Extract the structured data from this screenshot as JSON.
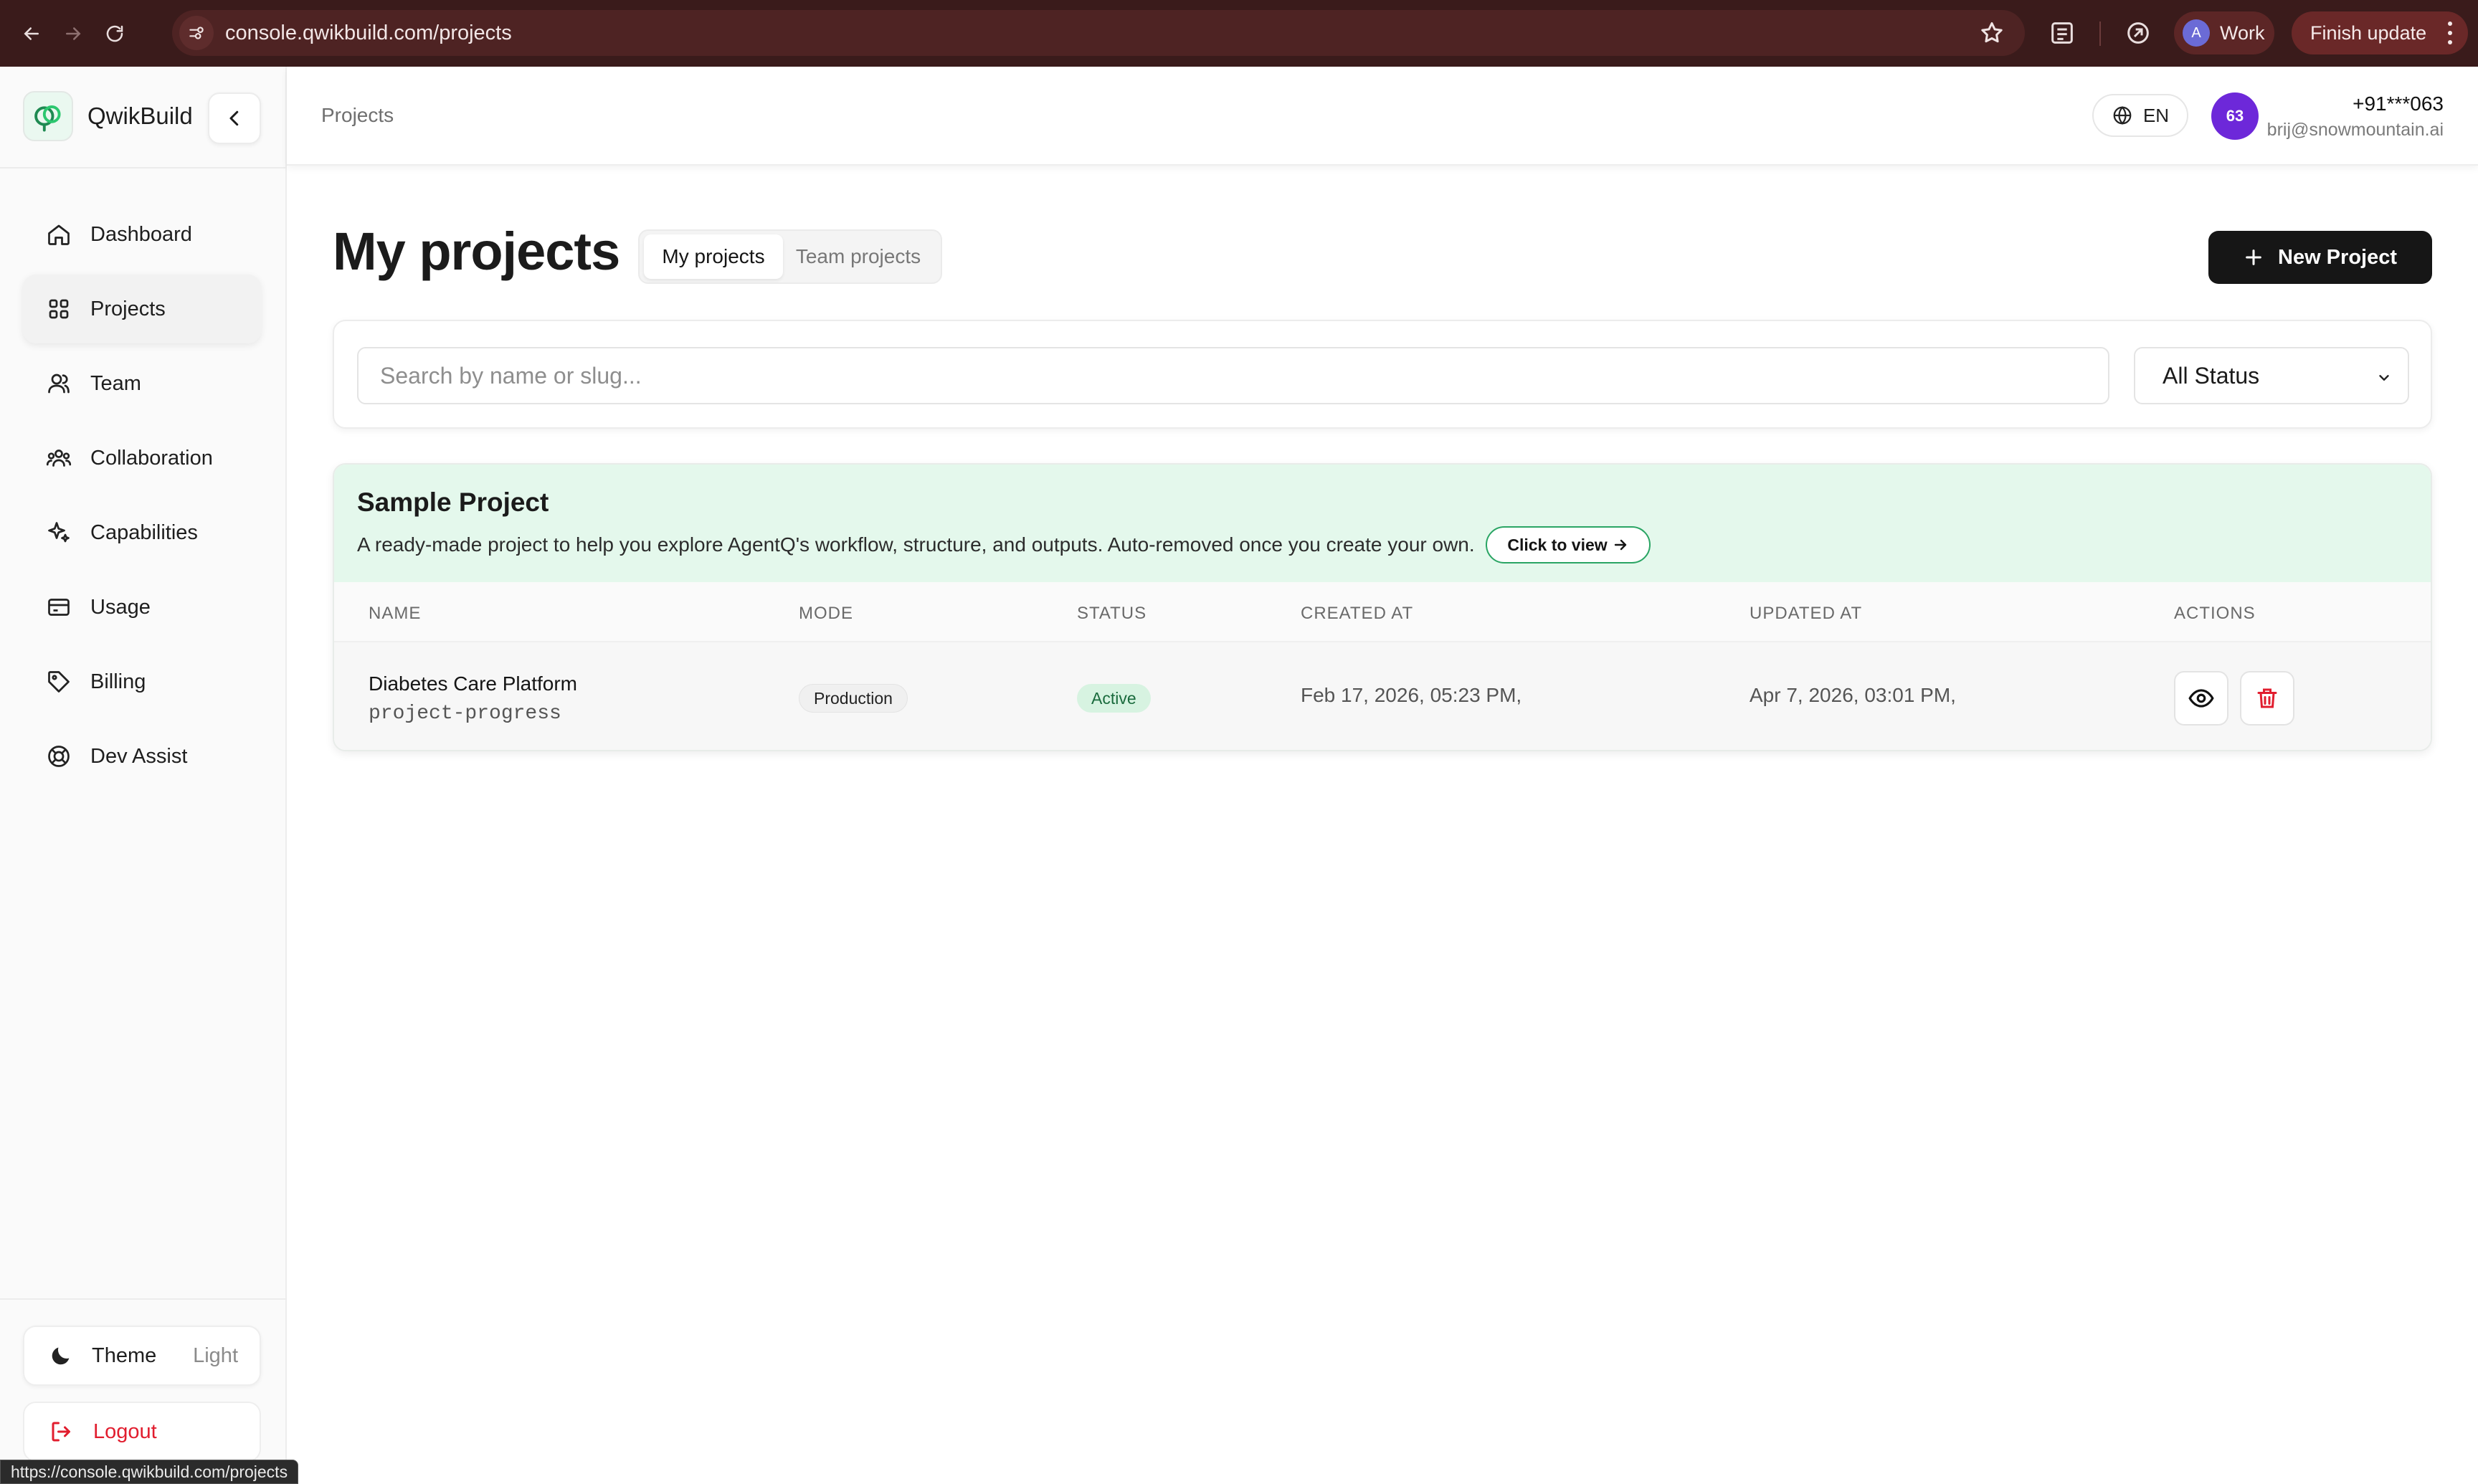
{
  "browser": {
    "url": "console.qwikbuild.com/projects",
    "profile_initial": "A",
    "profile_label": "Work",
    "update_label": "Finish update",
    "status_url": "https://console.qwikbuild.com/projects"
  },
  "sidebar": {
    "brand": "QwikBuild",
    "items": [
      {
        "label": "Dashboard",
        "icon": "home-icon"
      },
      {
        "label": "Projects",
        "icon": "grid-icon",
        "active": true
      },
      {
        "label": "Team",
        "icon": "users-icon"
      },
      {
        "label": "Collaboration",
        "icon": "group-icon"
      },
      {
        "label": "Capabilities",
        "icon": "sparkle-icon"
      },
      {
        "label": "Usage",
        "icon": "card-icon"
      },
      {
        "label": "Billing",
        "icon": "tag-icon"
      },
      {
        "label": "Dev Assist",
        "icon": "lifebuoy-icon"
      }
    ],
    "theme_label": "Theme",
    "theme_value": "Light",
    "logout_label": "Logout"
  },
  "header": {
    "breadcrumb": "Projects",
    "lang": "EN",
    "avatar": "63",
    "phone": "+91***063",
    "email": "brij@snowmountain.ai"
  },
  "main": {
    "title": "My projects",
    "tabs": [
      "My projects",
      "Team projects"
    ],
    "new_project": "New Project",
    "search_placeholder": "Search by name or slug...",
    "status_filter": "All Status"
  },
  "sample": {
    "title": "Sample Project",
    "description": "A ready-made project to help you explore AgentQ's workflow, structure, and outputs. Auto-removed once you create your own.",
    "view_label": "Click to view"
  },
  "table": {
    "headers": [
      "NAME",
      "MODE",
      "STATUS",
      "CREATED AT",
      "UPDATED AT",
      "ACTIONS"
    ],
    "rows": [
      {
        "name": "Diabetes Care Platform",
        "slug": "project-progress",
        "mode": "Production",
        "status": "Active",
        "created": "Feb 17, 2026, 05:23 PM,",
        "updated": "Apr 7, 2026, 03:01 PM,"
      }
    ]
  },
  "colors": {
    "accent_dark": "#161616",
    "sample_bg": "#e4f8ec",
    "active_badge": "#d7f3e1",
    "danger": "#e11d2e",
    "avatar": "#6d28d9",
    "chrome": "#3a1b1b"
  }
}
